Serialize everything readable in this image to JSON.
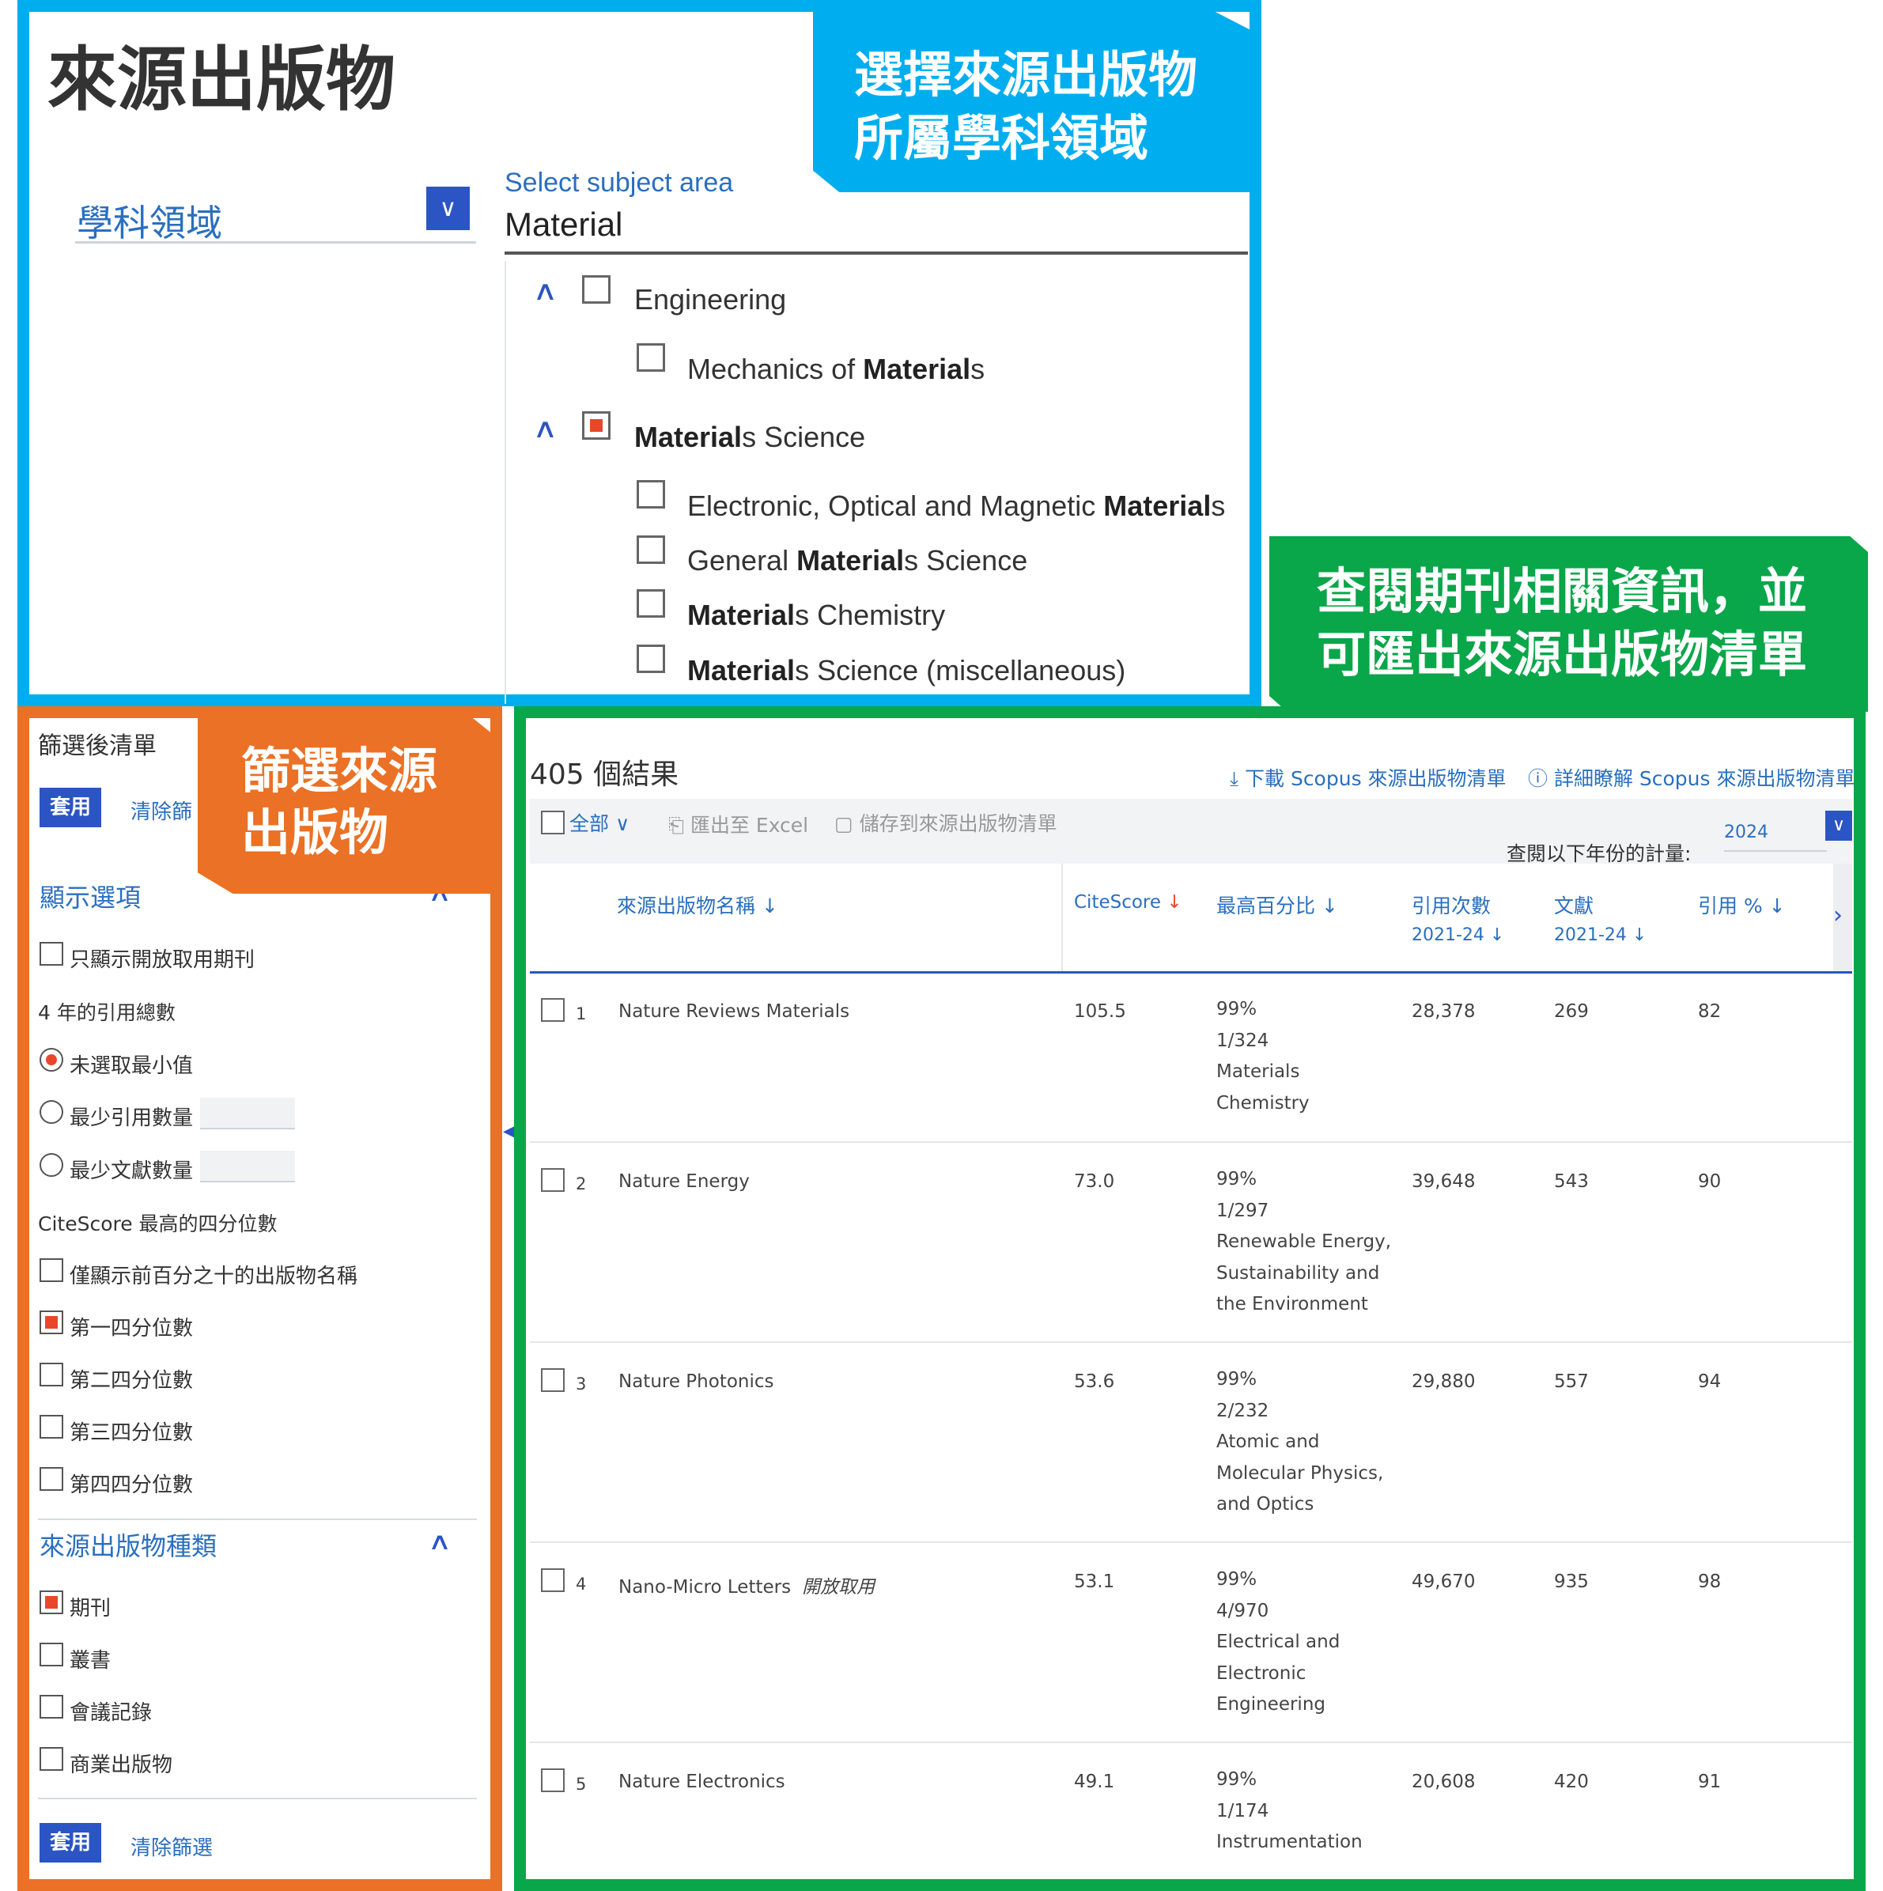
{
  "callouts": {
    "subject_line1": "選擇來源出版物",
    "subject_line2": "所屬學科領域",
    "results_line1": "查閱期刊相關資訊，並",
    "results_line2": "可匯出來源出版物清單",
    "filter_line1": "篩選來源",
    "filter_line2": "出版物"
  },
  "subject_panel": {
    "page_title": "來源出版物",
    "subject_dropdown_label": "學科領域",
    "select_caption": "Select subject area",
    "select_value": "Material",
    "tree": {
      "engineering": {
        "label": "Engineering",
        "checked": false
      },
      "mechanics_pre": "Mechanics of ",
      "mechanics_bold": "Material",
      "mechanics_post": "s",
      "matsci_bold": "Material",
      "matsci_post": "s Science",
      "electronic_pre": "Electronic, Optical and Magnetic ",
      "electronic_bold": "Material",
      "electronic_post": "s",
      "general_pre": "General ",
      "general_bold": "Material",
      "general_post": "s Science",
      "chem_bold": "Material",
      "chem_post": "s Chemistry",
      "misc_bold": "Material",
      "misc_post": "s Science (miscellaneous)"
    }
  },
  "filter_panel": {
    "title": "篩選後清單",
    "apply_label": "套用",
    "clear_label": "清除篩選",
    "clear_label_truncated": "清除篩",
    "display_options": "顯示選項",
    "open_access_only": "只顯示開放取用期刊",
    "citation_total": "4 年的引用總數",
    "no_min": "未選取最小值",
    "min_citations": "最少引用數量",
    "min_documents": "最少文獻數量",
    "citescore_quartile": "CiteScore 最高的四分位數",
    "top10": "僅顯示前百分之十的出版物名稱",
    "q1": "第一四分位數",
    "q2": "第二四分位數",
    "q3": "第三四分位數",
    "q4": "第四四分位數",
    "source_type": "來源出版物種類",
    "journal": "期刊",
    "book_series": "叢書",
    "conference": "會議記錄",
    "trade": "商業出版物"
  },
  "results_panel": {
    "count": "405 個結果",
    "download_link": "下載 Scopus 來源出版物清單",
    "learn_more_link": "詳細瞭解 Scopus 來源出版物清單",
    "all_label": "全部",
    "export_excel": "匯出至 Excel",
    "save_to_list": "儲存到來源出版物清單",
    "year_label": "查閱以下年份的計量:",
    "year_value": "2024",
    "columns": {
      "name": "來源出版物名稱",
      "citescore": "CiteScore",
      "percentile": "最高百分比",
      "citations": "引用次數",
      "citations_years": "2021-24",
      "documents": "文獻",
      "documents_years": "2021-24",
      "cited_pct": "引用 %"
    },
    "rows": [
      {
        "num": "1",
        "name": "Nature Reviews Materials",
        "oa": "",
        "citescore": "105.5",
        "pct": "99%",
        "rank": "1/324",
        "category": [
          "Materials",
          "Chemistry"
        ],
        "citations": "28,378",
        "documents": "269",
        "cited": "82"
      },
      {
        "num": "2",
        "name": "Nature Energy",
        "oa": "",
        "citescore": "73.0",
        "pct": "99%",
        "rank": "1/297",
        "category": [
          "Renewable Energy,",
          "Sustainability and",
          "the Environment"
        ],
        "citations": "39,648",
        "documents": "543",
        "cited": "90"
      },
      {
        "num": "3",
        "name": "Nature Photonics",
        "oa": "",
        "citescore": "53.6",
        "pct": "99%",
        "rank": "2/232",
        "category": [
          "Atomic and",
          "Molecular Physics,",
          "and Optics"
        ],
        "citations": "29,880",
        "documents": "557",
        "cited": "94"
      },
      {
        "num": "4",
        "name": "Nano-Micro Letters",
        "oa": "開放取用",
        "citescore": "53.1",
        "pct": "99%",
        "rank": "4/970",
        "category": [
          "Electrical and",
          "Electronic",
          "Engineering"
        ],
        "citations": "49,670",
        "documents": "935",
        "cited": "98"
      },
      {
        "num": "5",
        "name": "Nature Electronics",
        "oa": "",
        "citescore": "49.1",
        "pct": "99%",
        "rank": "1/174",
        "category": [
          "Instrumentation"
        ],
        "citations": "20,608",
        "documents": "420",
        "cited": "91"
      }
    ]
  },
  "colors": {
    "blue_frame": "#00aeef",
    "green_frame": "#0aa64a",
    "orange_frame": "#ea7125",
    "accent": "#2b55c4",
    "checked": "#e8472a"
  }
}
